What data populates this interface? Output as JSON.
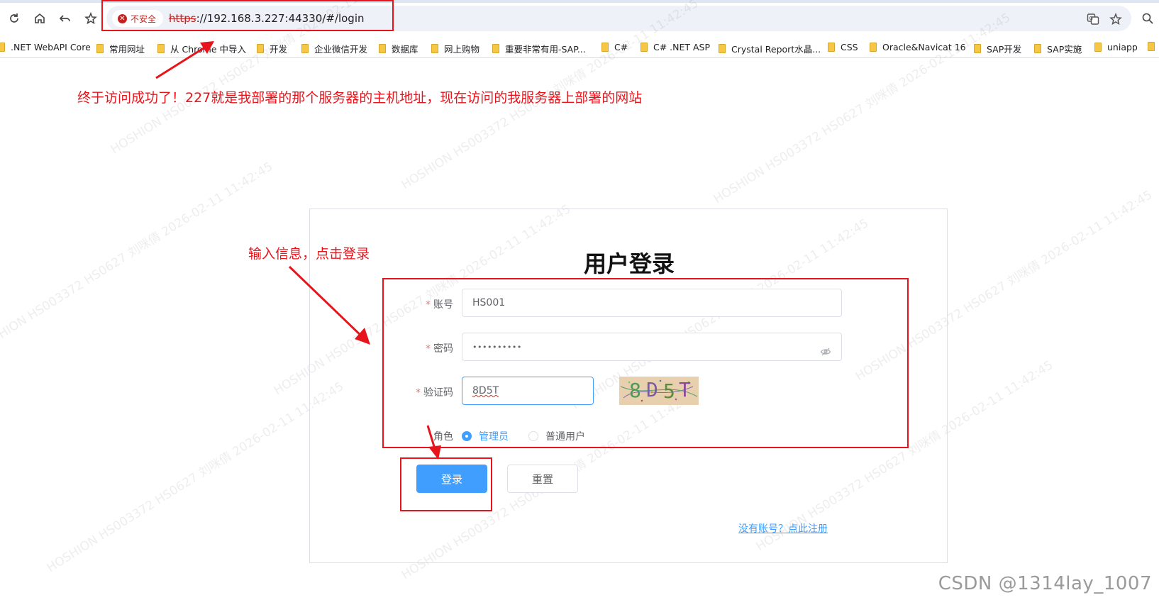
{
  "browser": {
    "security_label": "不安全",
    "url_protocol": "https",
    "url_rest": "://192.168.3.227:44330/#/login",
    "nav_icons": [
      "reload-icon",
      "home-icon",
      "back-icon",
      "star-icon"
    ],
    "right_icons": [
      "translate-icon",
      "bookmark-star-icon"
    ],
    "bookmarks": [
      ".NET WebAPI Core",
      "常用网址",
      "从 Chrome 中导入",
      "开发",
      "企业微信开发",
      "数据库",
      "网上购物",
      "重要非常有用-SAP...",
      "C#",
      "C# .NET ASP",
      "Crystal Report水晶...",
      "CSS",
      "Oracle&Navicat 16",
      "SAP开发",
      "SAP实施",
      "uniapp"
    ]
  },
  "login": {
    "title": "用户登录",
    "required_mark": "*",
    "account_label": "账号",
    "account_value": "HS001",
    "password_label": "密码",
    "password_value": "••••••••••",
    "captcha_label": "验证码",
    "captcha_value": "8D5T",
    "captcha_image_text": [
      "8",
      "D",
      "5",
      "T"
    ],
    "role_label": "角色",
    "role_options": [
      "管理员",
      "普通用户"
    ],
    "role_selected": "管理员",
    "login_button": "登录",
    "reset_button": "重置",
    "register_link": "没有账号？点此注册"
  },
  "annotations": {
    "note_top": "终于访问成功了！227就是我部署的那个服务器的主机地址，现在访问的我服务器上部署的网站",
    "note_form": "输入信息，点击登录",
    "color": "#e8141b"
  },
  "watermark": {
    "text": "HOSHION HS003372 HS0627 刘咪倩 2026-02-11 11:42:45"
  },
  "footer": {
    "csdn": "CSDN @1314lay_1007"
  },
  "colors": {
    "primary": "#409eff",
    "danger": "#f56c6c",
    "annotation_red": "#e8141b"
  }
}
